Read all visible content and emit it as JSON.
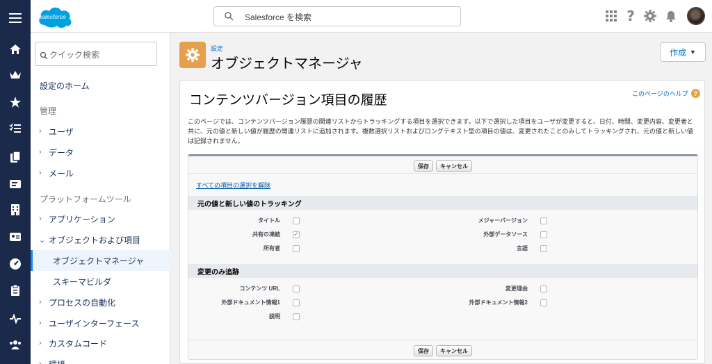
{
  "header": {
    "logo_text": "salesforce",
    "search_placeholder": "Salesforce を検索",
    "icons": [
      "app-launcher-icon",
      "help-icon",
      "gear-icon",
      "bell-icon"
    ]
  },
  "rail": {
    "icons": [
      "menu-icon",
      "home-icon",
      "crown-icon",
      "star-icon",
      "checklist-icon",
      "copy-icon",
      "cards-icon",
      "building-icon",
      "contact-card-icon",
      "gauge-icon",
      "clipboard-icon",
      "pulse-icon",
      "people-icon"
    ]
  },
  "sidebar": {
    "quick_search_placeholder": "クイック検索",
    "setup_home": "設定のホーム",
    "section_admin": "管理",
    "admin_items": [
      "ユーザ",
      "データ",
      "メール"
    ],
    "section_platform": "プラットフォームツール",
    "platform_items": [
      "アプリケーション",
      "オブジェクトおよび項目"
    ],
    "sub_items": [
      "オブジェクトマネージャ",
      "スキーマビルダ"
    ],
    "more_items": [
      "プロセスの自動化",
      "ユーザインターフェース",
      "カスタムコード",
      "環境"
    ]
  },
  "page": {
    "breadcrumb": "設定",
    "title": "オブジェクトマネージャ",
    "create_button": "作成"
  },
  "card": {
    "title": "コンテンツバージョン項目の履歴",
    "help_link": "このページのヘルプ",
    "description": "このページでは、コンテンツバージョン履歴の関連リストからトラッキングする項目を選択できます。以下で選択した項目をユーザが変更すると、日付、時間、変更内容、変更者と共に、元の値と新しい値が履歴の関連リストに追加されます。複数選択リストおよびロングテキスト型の項目の値は、変更されたことのみしてトラッキングされ、元の値と新しい値は記録されません。",
    "save": "保存",
    "cancel": "キャンセル",
    "deselect_all": "すべての項目の選択を解除",
    "section1_title": "元の値と新しい値のトラッキング",
    "section1_fields": [
      {
        "label": "タイトル",
        "checked": false
      },
      {
        "label": "メジャーバージョン",
        "checked": false
      },
      {
        "label": "共有の凍結",
        "checked": true
      },
      {
        "label": "外部データソース",
        "checked": false
      },
      {
        "label": "所有者",
        "checked": false
      },
      {
        "label": "言語",
        "checked": false
      }
    ],
    "section2_title": "変更のみ追跡",
    "section2_fields": [
      {
        "label": "コンテンツ URL",
        "checked": false
      },
      {
        "label": "変更理由",
        "checked": false
      },
      {
        "label": "外部ドキュメント情報1",
        "checked": false
      },
      {
        "label": "外部ドキュメント情報2",
        "checked": false
      },
      {
        "label": "説明",
        "checked": false
      }
    ]
  },
  "colors": {
    "rail": "#1b2a4a",
    "accent": "#0070d2",
    "setup_icon": "#e6a04d"
  }
}
